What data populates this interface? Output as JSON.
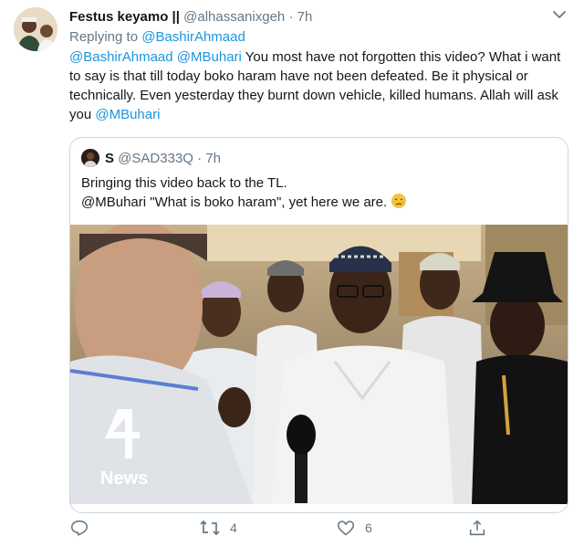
{
  "tweet": {
    "author_name": "Festus keyamo ||",
    "author_handle": "@alhassanixgeh",
    "dot": "·",
    "time": "7h",
    "replying_prefix": "Replying to",
    "replying_to": "@BashirAhmaad",
    "mention_1": "@BashirAhmaad",
    "mention_2": "@MBuhari",
    "text_main": " You most have not forgotten this video? What i want to say is that till today boko haram have not been defeated. Be it physical or technically. Even yesterday they burnt down vehicle, killed humans. Allah will ask you ",
    "mention_3": "@MBuhari"
  },
  "quoted_tweet": {
    "author_name": "S",
    "author_handle": "@SAD333Q",
    "dot": "·",
    "time": "7h",
    "line_1": "Bringing this video back to the TL.",
    "line_2": "@MBuhari \"What is boko haram\", yet here we are.",
    "emoji_icon": "sad-relieved-face-emoji",
    "video_watermark": "News",
    "video_logo": "channel-4-logo"
  },
  "actions": {
    "reply_icon": "reply-icon",
    "retweet_icon": "retweet-icon",
    "retweet_count": "4",
    "like_icon": "heart-icon",
    "like_count": "6",
    "share_icon": "share-icon"
  },
  "colors": {
    "link": "#1b95e0",
    "secondary_text": "#657786",
    "border": "#ccd6dd"
  }
}
